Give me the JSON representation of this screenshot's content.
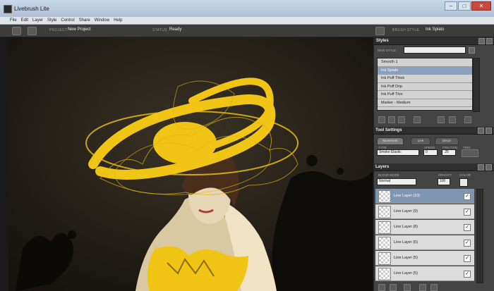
{
  "window": {
    "title": "Livebrush Lite",
    "minimize": "–",
    "maximize": "□",
    "close": "✕"
  },
  "menu": [
    "File",
    "Edit",
    "Layer",
    "Style",
    "Control",
    "Share",
    "Window",
    "Help"
  ],
  "toolbar": {
    "project_label": "PROJECT",
    "project_value": "New Project",
    "status_label": "STATUS",
    "status_value": "Ready",
    "brush_style_label": "BRUSH STYLE",
    "brush_style_value": "Ink Splats"
  },
  "styles_panel": {
    "title": "Styles",
    "new_style_label": "NEW STYLE",
    "new_style_value": "",
    "items": [
      {
        "label": "Smooth 1"
      },
      {
        "label": "Ink Splats",
        "selected": true
      },
      {
        "label": "Ink Puff Thick"
      },
      {
        "label": "Ink Puff Drip"
      },
      {
        "label": "Ink Puff Thin"
      },
      {
        "label": "Marker - Medium"
      }
    ]
  },
  "tool_settings": {
    "title": "Tool Settings",
    "tabs": [
      "Movement",
      "Line",
      "Decor"
    ],
    "field1_label": "TYPE",
    "field1_value": "Smoke Elastic",
    "field2_label": "SPEED",
    "field2_value": "0",
    "field3_label": "FRICTION",
    "field3_value": ".25",
    "field4_label": "TRIG"
  },
  "layers_panel": {
    "title": "Layers",
    "blend_mode_label": "BLEND MODE",
    "blend_mode_value": "Normal",
    "opacity_label": "OPACITY",
    "opacity_value": "100",
    "color_label": "COLOR",
    "check": "✓",
    "layers": [
      {
        "label": "Line Layer (10)",
        "selected": true
      },
      {
        "label": "Line Layer (9)"
      },
      {
        "label": "Line Layer (8)"
      },
      {
        "label": "Line Layer (6)"
      },
      {
        "label": "Line Layer (5)"
      },
      {
        "label": "Line Layer (5)"
      }
    ]
  },
  "colors": {
    "accent_yellow": "#f0c515",
    "selection_blue": "#7f96b3",
    "canvas_bg": "#241f18"
  }
}
